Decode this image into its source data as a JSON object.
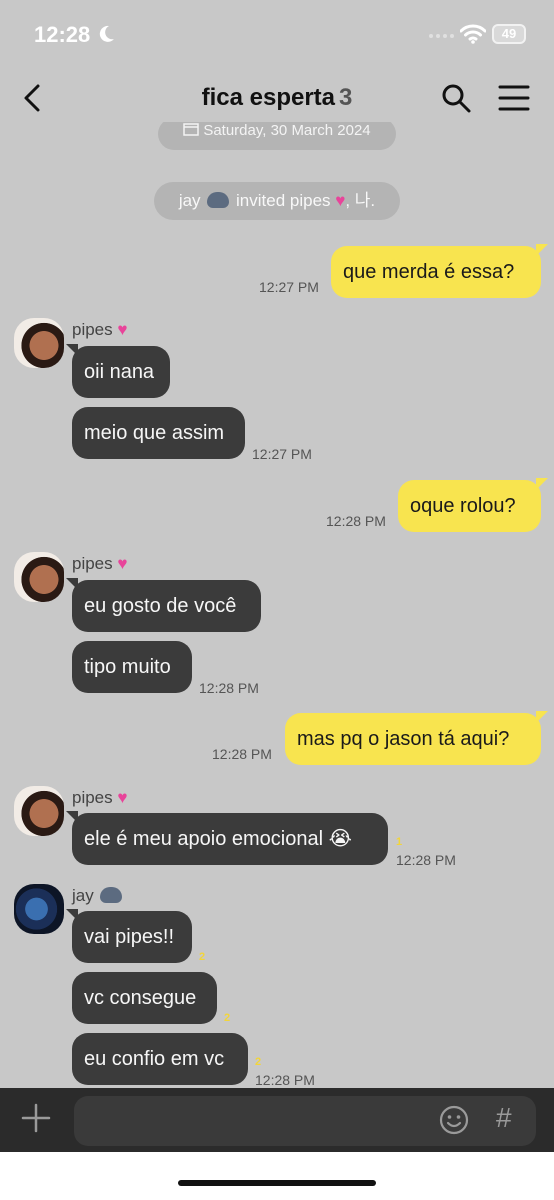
{
  "status_bar": {
    "time": "12:28",
    "battery": "49"
  },
  "header": {
    "title": "fica esperta",
    "member_count": "3"
  },
  "date_pill": "Saturday, 30 March 2024",
  "invite_notice": {
    "prefix": "jay",
    "middle": " invited pipes ",
    "suffix": ", 나."
  },
  "messages": [
    {
      "text": "que merda é essa?",
      "time": "12:27 PM"
    },
    {
      "sender": "pipes",
      "text": "oii nana"
    },
    {
      "text": "meio que assim",
      "time": "12:27 PM"
    },
    {
      "text": "oque rolou?",
      "time": "12:28 PM"
    },
    {
      "sender": "pipes",
      "text": "eu gosto de você"
    },
    {
      "text": "tipo muito",
      "time": "12:28 PM"
    },
    {
      "text": "mas pq o jason tá aqui?",
      "time": "12:28 PM"
    },
    {
      "sender": "pipes",
      "text": "ele é meu apoio emocional 😭",
      "read": "1",
      "time": "12:28 PM"
    },
    {
      "sender": "jay",
      "text": "vai pipes!!",
      "read": "2"
    },
    {
      "text": "vc consegue",
      "read": "2"
    },
    {
      "text": "eu confio em vc",
      "read": "2",
      "time": "12:28 PM"
    }
  ],
  "colors": {
    "background": "#c8c8c8",
    "my_bubble": "#f8e44f",
    "their_bubble": "#3b3b3b",
    "composer": "#2b2b2b",
    "heart": "#e8449a"
  },
  "icons": [
    "back-icon",
    "search-icon",
    "menu-icon",
    "plus-icon",
    "emoji-icon",
    "hash-icon",
    "calendar-icon",
    "heart-icon"
  ]
}
